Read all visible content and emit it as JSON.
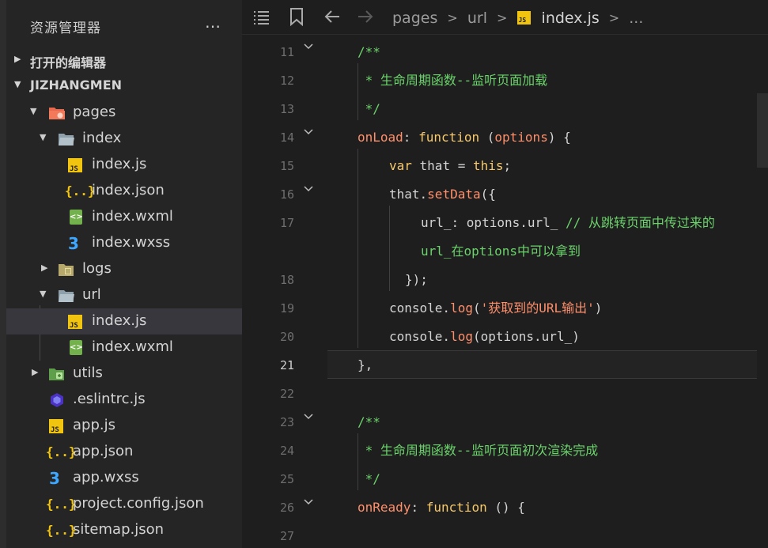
{
  "sidebar": {
    "title": "资源管理器",
    "more_label": "…",
    "open_editors_label": "打开的编辑器",
    "project_label": "JIZHANGMEN",
    "tree": [
      {
        "label": "pages",
        "icon": "folder-pages-icon"
      },
      {
        "label": "index",
        "icon": "folder-open-icon"
      },
      {
        "label": "index.js",
        "icon": "js-file-icon"
      },
      {
        "label": "index.json",
        "icon": "json-file-icon"
      },
      {
        "label": "index.wxml",
        "icon": "wxml-file-icon"
      },
      {
        "label": "index.wxss",
        "icon": "wxss-file-icon"
      },
      {
        "label": "logs",
        "icon": "folder-icon"
      },
      {
        "label": "url",
        "icon": "folder-open-icon"
      },
      {
        "label": "index.js",
        "icon": "js-file-icon"
      },
      {
        "label": "index.wxml",
        "icon": "wxml-file-icon"
      },
      {
        "label": "utils",
        "icon": "folder-utils-icon"
      },
      {
        "label": ".eslintrc.js",
        "icon": "eslint-file-icon"
      },
      {
        "label": "app.js",
        "icon": "js-file-icon"
      },
      {
        "label": "app.json",
        "icon": "json-file-icon"
      },
      {
        "label": "app.wxss",
        "icon": "wxss-file-icon"
      },
      {
        "label": "project.config.json",
        "icon": "json-file-icon"
      },
      {
        "label": "sitemap.json",
        "icon": "json-file-icon"
      }
    ]
  },
  "toolbar": {
    "breadcrumb": [
      "pages",
      "url",
      "index.js",
      "..."
    ],
    "js_badge": "JS",
    "sep": ">"
  },
  "editor": {
    "active_line": 21,
    "lines": [
      {
        "n": "11",
        "text": "/**"
      },
      {
        "n": "12",
        "text": " * 生命周期函数--监听页面加载"
      },
      {
        "n": "13",
        "text": " */"
      },
      {
        "n": "14",
        "text": "onLoad: function (options) {"
      },
      {
        "n": "15",
        "text": "var that = this;"
      },
      {
        "n": "16",
        "text": "that.setData({"
      },
      {
        "n": "17",
        "text": "url_: options.url_ // 从跳转页面中传过来的"
      },
      {
        "n": "",
        "text": "url_在options中可以拿到"
      },
      {
        "n": "18",
        "text": "});"
      },
      {
        "n": "19",
        "text": "console.log('获取到的URL输出')"
      },
      {
        "n": "20",
        "text": "console.log(options.url_)"
      },
      {
        "n": "21",
        "text": "},"
      },
      {
        "n": "22",
        "text": ""
      },
      {
        "n": "23",
        "text": "/**"
      },
      {
        "n": "24",
        "text": " * 生命周期函数--监听页面初次渲染完成"
      },
      {
        "n": "25",
        "text": " */"
      },
      {
        "n": "26",
        "text": "onReady: function () {"
      },
      {
        "n": "27",
        "text": ""
      }
    ],
    "tokens": {
      "c11": "/**",
      "c12": " * 生命周期函数--监听页面加载",
      "c13": " */",
      "onload": "onLoad",
      "colon": ": ",
      "function": "function",
      "lparen": " (",
      "options": "options",
      "rparen_brace": ") {",
      "var": "var",
      "that_eq": " that = ",
      "this": "this",
      "semi": ";",
      "that_dot": "that.",
      "setdata": "setData",
      "paren_brace": "({",
      "url_key": "url_: options.url_ ",
      "comment17": "// 从跳转页面中传过来的",
      "comment17b": "url_在options中可以拿到",
      "close18": "});",
      "console_dot": "console.",
      "log": "log",
      "paren_open": "(",
      "str19": "'获取到的URL输出'",
      "paren_close": ")",
      "args20": "options.url_",
      "close21": "},",
      "c23": "/**",
      "c24": " * 生命周期函数--监听页面初次渲染完成",
      "c25": " */",
      "onready": "onReady",
      "empty_args": " () {"
    }
  },
  "colors": {
    "keyword": "#f7ca6b",
    "comment": "#6bd36b",
    "string": "#ff8f6b",
    "sidebar_bg": "#252526",
    "editor_bg": "#1e1e1e",
    "selection": "#37373d"
  }
}
